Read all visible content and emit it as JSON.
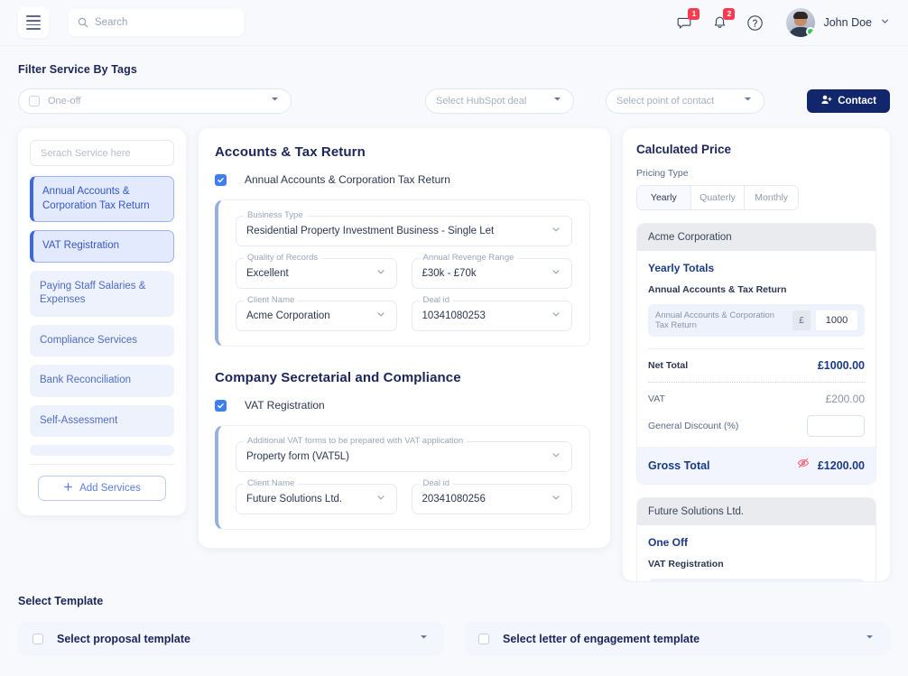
{
  "topbar": {
    "menu_icon": "hamburger-menu-icon",
    "search_placeholder": "Search",
    "search_value": "",
    "search_icon": "search-icon",
    "chat_icon": "chat-bubble-icon",
    "chat_badge": "1",
    "bell_icon": "bell-icon",
    "bell_badge": "2",
    "help_icon": "help-circle-icon",
    "user_name": "John Doe",
    "chevron_icon": "chevron-down-icon",
    "status": "online"
  },
  "filter": {
    "title": "Filter  Service By Tags",
    "tag_select": "One-off",
    "hubspot_select": "Select HubSpot deal",
    "contact_select": "Select point of contact",
    "contact_button": "Contact",
    "contact_icon": "user-plus-icon"
  },
  "services_panel": {
    "search_placeholder": "Serach Service here",
    "search_value": "",
    "items": [
      {
        "label": "Annual Accounts & Corporation Tax Return",
        "active": true
      },
      {
        "label": "VAT Registration",
        "active": true
      },
      {
        "label": "Paying Staff Salaries & Expenses",
        "active": false
      },
      {
        "label": "Compliance Services",
        "active": false
      },
      {
        "label": "Bank Reconciliation",
        "active": false
      },
      {
        "label": "Self-Assessment",
        "active": false
      }
    ],
    "add_button": "Add Services",
    "add_icon": "plus-icon"
  },
  "form": {
    "sections": [
      {
        "title": "Accounts & Tax Return",
        "checkbox_label": "Annual Accounts & Corporation Tax Return",
        "checked": true,
        "fields": [
          {
            "legend": "Business Type",
            "value": "Residential Property Investment Business - Single Let",
            "full": true
          },
          {
            "legend": "Quality of Records",
            "value": "Excellent",
            "full": false
          },
          {
            "legend": "Annual Revenge Range",
            "value": "£30k - £70k",
            "full": false
          },
          {
            "legend": "Client Name",
            "value": "Acme Corporation",
            "full": false
          },
          {
            "legend": "Deal id",
            "value": "10341080253",
            "full": false
          }
        ]
      },
      {
        "title": "Company Secretarial and Compliance",
        "checkbox_label": "VAT Registration",
        "checked": true,
        "fields": [
          {
            "legend": "Additional VAT forms to be prepared with VAT application",
            "value": "Property form (VAT5L)",
            "full": true
          },
          {
            "legend": "Client Name",
            "value": "Future Solutions Ltd.",
            "full": false
          },
          {
            "legend": "Deal id",
            "value": "20341080256",
            "full": false
          }
        ]
      }
    ]
  },
  "price_panel": {
    "title": "Calculated Price",
    "pricing_type_label": "Pricing Type",
    "pricing_options": [
      "Yearly",
      "Quaterly",
      "Monthly"
    ],
    "pricing_selected": "Yearly",
    "blocks": [
      {
        "client": "Acme Corporation",
        "totals_heading": "Yearly Totals",
        "group_name": "Annual Accounts & Tax Return",
        "line_item": "Annual Accounts & Corporation Tax Return",
        "currency": "£",
        "amount": "1000",
        "net_total_label": "Net Total",
        "net_total_value": "£1000.00",
        "vat_label": "VAT",
        "vat_value": "£200.00",
        "discount_label": "General Discount (%)",
        "discount_value": "",
        "gross_label": "Gross Total",
        "gross_value": "£1200.00",
        "gross_icon": "eye-off-icon"
      },
      {
        "client": "Future Solutions Ltd.",
        "totals_heading": "One Off",
        "group_name": "VAT Registration"
      }
    ]
  },
  "template_section": {
    "title": "Select Template",
    "proposal_label": "Select proposal template",
    "engagement_label": "Select letter of engagement template",
    "chevron_icon": "chevron-down-icon"
  },
  "colors": {
    "page_bg": "#f7f9fc",
    "navy": "#1b2559",
    "accent_blue": "#3f7ef0",
    "contact_btn": "#12276b",
    "badge_red": "#fa3b4f",
    "online_green": "#2fc94e",
    "service_item_bg": "#eef2fd"
  }
}
